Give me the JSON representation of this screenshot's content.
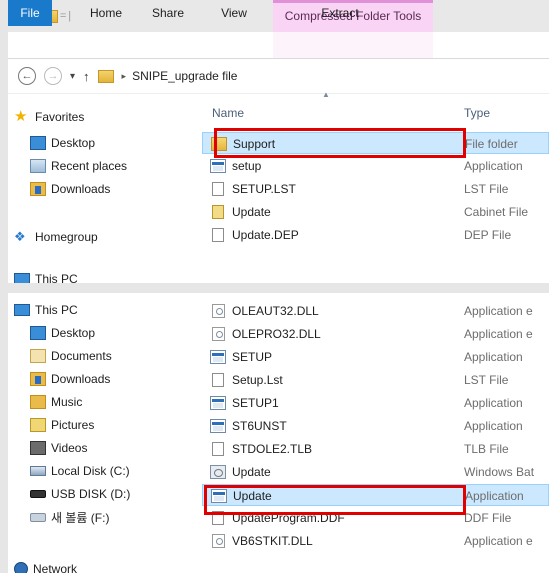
{
  "window": {
    "context_tab": "Compressed Folder Tools",
    "ribbon_tabs": [
      "File",
      "Home",
      "Share",
      "View",
      "Extract"
    ],
    "address": {
      "path": "SNIPE_upgrade file",
      "separator": "▸"
    }
  },
  "top_panel": {
    "nav": {
      "favorites": "Favorites",
      "items": [
        "Desktop",
        "Recent places",
        "Downloads"
      ],
      "homegroup": "Homegroup",
      "this_pc": "This PC"
    },
    "columns": {
      "name": "Name",
      "type": "Type"
    },
    "files": [
      {
        "name": "Support",
        "type": "File folder",
        "icon": "folder-icon",
        "selected": true
      },
      {
        "name": "setup",
        "type": "Application",
        "icon": "application-icon"
      },
      {
        "name": "SETUP.LST",
        "type": "LST File",
        "icon": "file-icon"
      },
      {
        "name": "Update",
        "type": "Cabinet File",
        "icon": "cabinet-icon"
      },
      {
        "name": "Update.DEP",
        "type": "DEP File",
        "icon": "file-icon"
      }
    ]
  },
  "bottom_panel": {
    "nav": {
      "this_pc": "This PC",
      "items": [
        "Desktop",
        "Documents",
        "Downloads",
        "Music",
        "Pictures",
        "Videos",
        "Local Disk (C:)",
        "USB DISK (D:)",
        "새 볼륨 (F:)"
      ],
      "network": "Network"
    },
    "files": [
      {
        "name": "OLEAUT32.DLL",
        "type": "Application e",
        "icon": "dll-icon"
      },
      {
        "name": "OLEPRO32.DLL",
        "type": "Application e",
        "icon": "dll-icon"
      },
      {
        "name": "SETUP",
        "type": "Application",
        "icon": "application-icon"
      },
      {
        "name": "Setup.Lst",
        "type": "LST File",
        "icon": "file-icon"
      },
      {
        "name": "SETUP1",
        "type": "Application",
        "icon": "application-icon"
      },
      {
        "name": "ST6UNST",
        "type": "Application",
        "icon": "application-icon"
      },
      {
        "name": "STDOLE2.TLB",
        "type": "TLB File",
        "icon": "file-icon"
      },
      {
        "name": "Update",
        "type": "Windows Bat",
        "icon": "batch-icon"
      },
      {
        "name": "Update",
        "type": "Application",
        "icon": "application-icon",
        "selected": true
      },
      {
        "name": "UpdateProgram.DDF",
        "type": "DDF File",
        "icon": "file-icon"
      },
      {
        "name": "VB6STKIT.DLL",
        "type": "Application e",
        "icon": "dll-icon"
      }
    ]
  },
  "colors": {
    "highlight": "#e00000",
    "selection": "#cce8ff",
    "file_tab": "#1979ca",
    "context_tab": "#f9d4f4"
  }
}
